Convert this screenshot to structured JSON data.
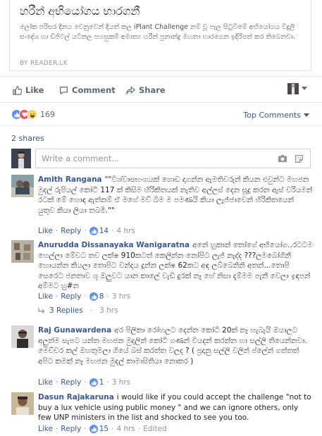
{
  "link_card": {
    "title": "හරීන් අභියෝගය භාරගනී",
    "description": "ලෝක පරිසර දිනය වෙනුවෙන් දියත් කල iPlant Challenge නම් වූ පැල සිටුවීමේ අභියෝගය විදුලි සංදේශ හා ඩිජිටල් යටිතල පහසුකම් අමාත්‍ය හරීන් ප්‍රනාන්දු මහතා භාරගෙන ඉදිරිපත් කර තිබෙනවා.",
    "source": "BY READER.LK"
  },
  "actions": {
    "like": "Like",
    "comment": "Comment",
    "share": "Share"
  },
  "reactions": {
    "count": "169",
    "icons": [
      "like-icon",
      "love-icon",
      "haha-icon"
    ],
    "colors": {
      "like": "#5890ff",
      "love": "#f25268",
      "haha": "#fcd664"
    }
  },
  "sort": {
    "label": "Top Comments"
  },
  "shares": "2 shares",
  "composer": {
    "placeholder": "Write a comment..."
  },
  "comments": [
    {
      "name": "Amith Rangana",
      "text": "\"\"විශ්වාසභංගයක් ගොඩ දාගන්න ඇමතිවරුන් කියන එවුන්ට මහජන මුදල් රුපියල් කෝටි 117 ක් කිසිම හිරිකිතයක් නැතිව අල්ලස් දෙන සූදු කරන ඇස් වරියමන් රටක් මේ හොඳ ඇත්නම් ඒ මගේ මව් බිම ම පමණයි කියා ලැජ්ජාවෙන් හිරිකිතයෙන් යුතුව කියා ලියා තබමි.\"\"",
      "like": "Like",
      "reply": "Reply",
      "likes": "14",
      "time": "4 hrs"
    },
    {
      "name": "Anurudda Dissanayaka Wanigaratna",
      "text": "අනේ හුකාන් තෝගේ අභියෝග..රටටම හෙල්ලා මේවට තව ලක්ෂ 910කටත් කෙලින්න නෝපිට ලැජ් නැද්ද ???ලමබෝගිනී හොයන්න කියලා තොපිට වන්දය දුන්න ලක්ෂ 62කට අඳ ලබ්බෙනිනි අතන්...තොපි සෙරෙට ජනතාව ශූ ඔලුවට යාන කාලේ වැඩි දුරක් නෑ හේ නිසා දැම්මම පැනී වෙලා ඉඳපන් අම්මට හු#න",
      "like": "Like",
      "reply": "Reply",
      "likes": "8",
      "time": "3 hrs"
    },
    {
      "name": "Raj Gunawardena",
      "text": "අර පිලිකා රෝහලට දෙන්න කෝටි 20ක් නෑ හැබැයි ඔයාලට අලුත්ම සැපට යන්න මහජන මුදලින් කෝටි ගණන් වියදන් කරන්න හා සල්ලි තියෙන්නවා. මෙච්චර කල් ඔහතුමලා ගියේ බස් කරත්ත වලද ? ( ප්‍රදානු සල්ලි වලින් ප්ලේන් ගත්තත් අපිට කමක් නෑ මහජන මුදල් කාමාසිතියා නොකර )",
      "like": "Like",
      "reply": "Reply",
      "likes": "1",
      "time": "3 hrs"
    },
    {
      "name": "Dasun Rajakaruna",
      "text": "i would like if you could accept the challenge \"not to buy a lux vehicle using public money \" and we can ignore others, only few UNP ministers in the list and shocked to see you too.",
      "like": "Like",
      "reply": "Reply",
      "likes": "15",
      "time": "4 hrs",
      "edited": "Edited"
    }
  ],
  "replies_link": "3 Replies",
  "replies_time": "3 hrs"
}
